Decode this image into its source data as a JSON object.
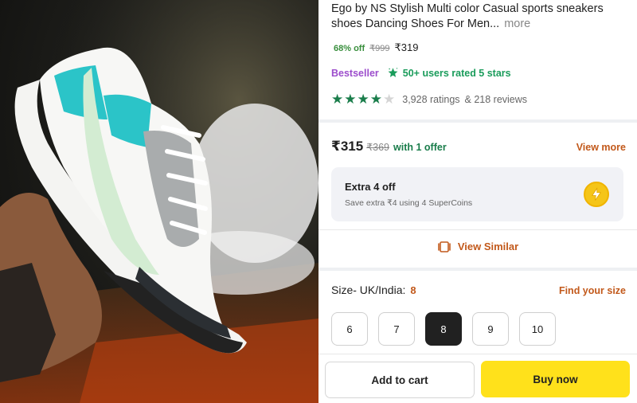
{
  "product": {
    "title": "Ego by NS Stylish Multi color Casual sports sneakers shoes Dancing Shoes For Men...",
    "more_label": "more",
    "discount": "68% off",
    "mrp": "₹999",
    "price": "₹319"
  },
  "badges": {
    "bestseller": "Bestseller",
    "rated": "50+ users rated 5 stars"
  },
  "ratings": {
    "stars_filled": 4,
    "stars_total": 5,
    "ratings_text": "3,928 ratings",
    "reviews_text": "& 218 reviews"
  },
  "offer": {
    "price": "₹315",
    "mrp": "₹369",
    "with_offer": "with 1 offer",
    "view_more": "View more"
  },
  "supercoins": {
    "title": "Extra 4 off",
    "subtitle": "Save extra ₹4 using 4 SuperCoins"
  },
  "view_similar": "View Similar",
  "size": {
    "label": "Size- UK/India:",
    "selected": "8",
    "find_size": "Find your size",
    "options": [
      "6",
      "7",
      "8",
      "9",
      "10"
    ]
  },
  "actions": {
    "add_to_cart": "Add to cart",
    "buy_now": "Buy now"
  },
  "colors": {
    "green": "#1a7d4b",
    "orange_accent": "#c2591b",
    "purple": "#9c4dcc",
    "buy_yellow": "#ffe11b"
  }
}
